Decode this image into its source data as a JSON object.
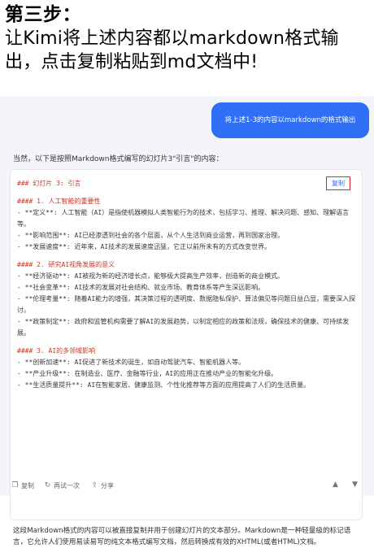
{
  "header": {
    "step_title": "第三步：",
    "description": "让Kimi将上述内容都以markdown格式输出，点击复制粘贴到md文档中!"
  },
  "user_message": "将上述1-3的内容以markdown的格式输出",
  "assistant": {
    "intro": "当然，以下是按照Markdown格式编写的幻灯片3\"引言\"的内容：",
    "copy_label": "复制",
    "code_lines": [
      "### 幻灯片 3: 引言",
      "",
      "#### 1. 人工智能的重要性",
      "- **定义**: 人工智能（AI）是指使机器模拟人类智能行为的技术，包括学习、推理、解决问题、感知、理解语言等。",
      "- **影响范围**: AI已经渗透到社会的各个层面，从个人生活到商业运营，再到国家治理。",
      "- **发展速度**: 近年来，AI技术的发展速度迅猛，它正以前所未有的方式改变世界。",
      "",
      "#### 2. 研究AI视角发展的意义",
      "- **经济驱动**: AI被视为新的经济增长点，能够极大提高生产效率，创造新的商业模式。",
      "- **社会变革**: AI技术的发展对社会结构、就业市场、教育体系等产生深远影响。",
      "- **伦理考量**: 随着AI能力的增强，其决策过程的透明度、数据隐私保护、算法偏见等问题日益凸显，需要深入探讨。",
      "- **政策制定**: 政府和监管机构需要了解AI的发展趋势，以制定相应的政策和法规，确保技术的健康、可持续发展。",
      "",
      "#### 3. AI的多领域影响",
      "- **创新加速**: AI促进了新技术的诞生，如自动驾驶汽车、智能机器人等。",
      "- **产业升级**: 在制造业、医疗、金融等行业，AI的应用正在推动产业的智能化升级。",
      "- **生活质量提升**: AI在智能家居、健康监测、个性化推荐等方面的应用提高了人们的生活质量。"
    ],
    "summary": "这段Markdown格式的内容可以被直接复制并用于创建幻灯片的文本部分。Markdown是一种轻量级的标记语言，它允许人们使用易读易写的纯文本格式编写文档，然后转换成有效的XHTML(或者HTML)文档。"
  },
  "toolbar": {
    "copy_label": "复制",
    "regenerate_label": "再试一次",
    "share_label": "分享",
    "icons": [
      "copy-icon",
      "refresh-icon",
      "share-icon",
      "thumb-up-icon",
      "thumb-down-icon"
    ]
  },
  "colors": {
    "bubble": "#2f6ff5",
    "copy_border": "#e3262b",
    "heading_text": "#c0392b"
  }
}
